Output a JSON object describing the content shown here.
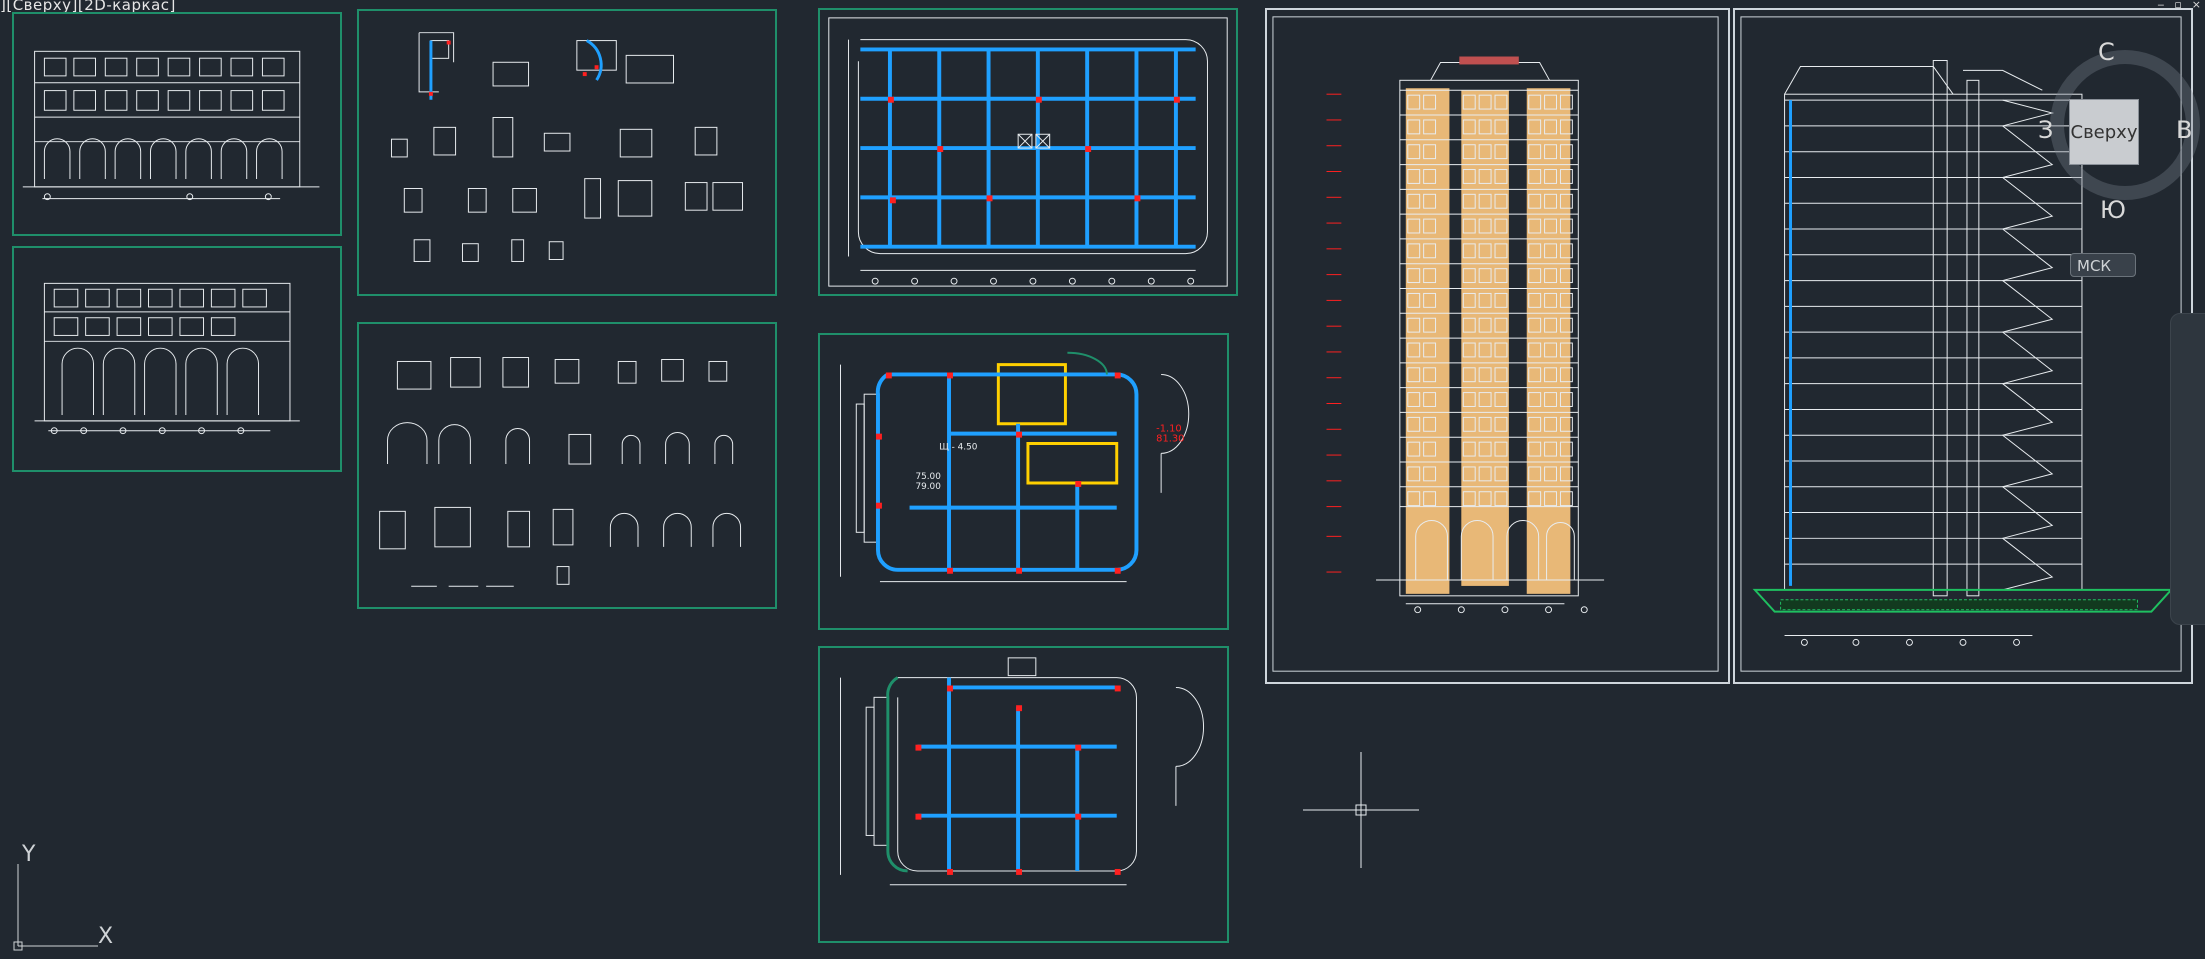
{
  "viewport": {
    "label": "][Сверху][2D-каркас]"
  },
  "window_controls": [
    "‒",
    "▫",
    "×"
  ],
  "sheets": [
    {
      "id": "facade-small-1",
      "kind": "facade"
    },
    {
      "id": "facade-small-2",
      "kind": "facade"
    },
    {
      "id": "details-1",
      "kind": "details"
    },
    {
      "id": "details-2",
      "kind": "details"
    },
    {
      "id": "floor-plan-1",
      "kind": "plan"
    },
    {
      "id": "floor-plan-2",
      "kind": "plan"
    },
    {
      "id": "floor-plan-3",
      "kind": "plan"
    },
    {
      "id": "tower-elevation",
      "kind": "elevation"
    },
    {
      "id": "tower-section",
      "kind": "section"
    }
  ],
  "viewcube": {
    "face_label": "Сверху",
    "north": "С",
    "south": "Ю",
    "east": "В",
    "west": "З"
  },
  "ucs_button": {
    "label": "МСК"
  },
  "ucs_axes": {
    "x": "X",
    "y": "Y"
  },
  "plan_annotations": {
    "level_1": "-1.10",
    "level_2": "81.30",
    "mark_1": "Щ - 4.50",
    "mark_2": "75.00",
    "mark_3": "79.00"
  },
  "colors": {
    "background": "#212830",
    "sheet_border": "#1f8f6a",
    "drawing_line": "#e8ecef",
    "wall_blue": "#1fa0ff",
    "column_red": "#ff2020",
    "facade_fill": "#e8b877"
  }
}
